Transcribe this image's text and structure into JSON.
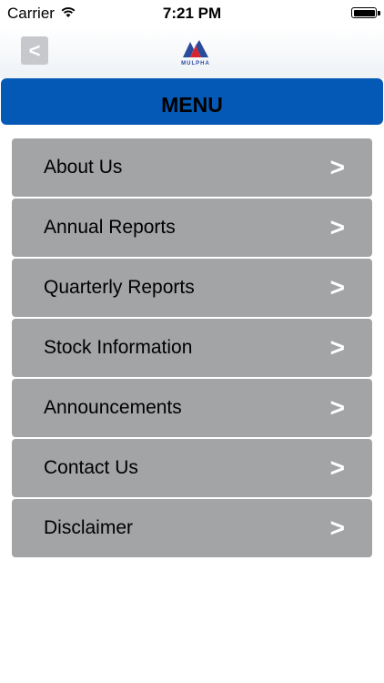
{
  "status_bar": {
    "carrier": "Carrier",
    "time": "7:21 PM"
  },
  "nav": {
    "back_label": "<",
    "logo_text": "MULPHA"
  },
  "menu": {
    "title": "MENU",
    "chevron": ">",
    "items": [
      {
        "label": "About Us"
      },
      {
        "label": "Annual Reports"
      },
      {
        "label": "Quarterly Reports"
      },
      {
        "label": "Stock Information"
      },
      {
        "label": "Announcements"
      },
      {
        "label": "Contact Us"
      },
      {
        "label": "Disclaimer"
      }
    ]
  },
  "colors": {
    "header_blue": "#0559b6",
    "item_gray": "#a3a4a6",
    "logo_red": "#d9232e",
    "logo_blue": "#2a4a9a"
  }
}
